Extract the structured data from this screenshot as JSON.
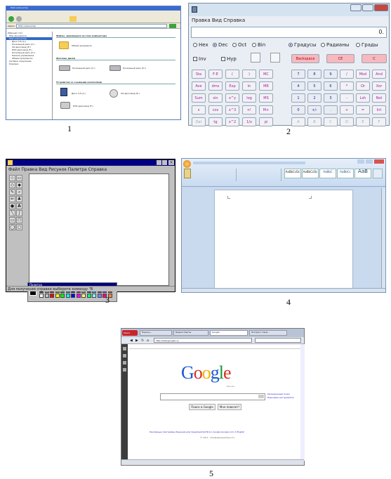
{
  "captions": [
    "1",
    "2",
    "3",
    "4",
    "5"
  ],
  "explorer": {
    "title": "Мой компьютер",
    "address_label": "Адрес:",
    "address_value": "Мой компьютер",
    "section_files": "Файлы, хранящиеся на этом компьютере",
    "shared_docs": "Общие документы",
    "section_hdd": "Жесткие диски",
    "drive_c": "Локальный диск (C:)",
    "drive_d": "Локальный диск (D:)",
    "section_removable": "Устройства со съемными носителями",
    "drive_a": "Диск 3,5 (A:)",
    "drive_cd": "CD-дисковод (E:)",
    "drive_dvd": "DVD-дисковод (F:)",
    "tree": [
      "Рабочий стол",
      "Мои документы",
      "Мой компьютер",
      "Диск 3,5 (A:)",
      "Локальный диск (C:)",
      "CD-дисковод (E:)",
      "DVD-дисковод (F:)",
      "Локальный диск (D:)",
      "Панель управления",
      "Общие документы",
      "Сетевое окружение",
      "Корзина"
    ]
  },
  "calculator": {
    "menu": "Правка  Вид  Справка",
    "display": "0.",
    "radios": [
      "Hex",
      "Dec",
      "Oct",
      "Bin"
    ],
    "angle_radios": [
      "Градусы",
      "Радианы",
      "Грады"
    ],
    "checks": [
      "Inv",
      "Hyp"
    ],
    "top_keys": [
      "Backspace",
      "CE",
      "C"
    ],
    "func_keys": [
      [
        "Sta",
        "F-E",
        "(",
        ")",
        "MC"
      ],
      [
        "Ave",
        "dms",
        "Exp",
        "ln",
        "MR"
      ],
      [
        "Sum",
        "sin",
        "x^y",
        "log",
        "MS"
      ],
      [
        "s",
        "cos",
        "x^3",
        "n!",
        "M+"
      ],
      [
        "Dat",
        "tg",
        "x^2",
        "1/x",
        "pi"
      ]
    ],
    "num_keys": [
      [
        "7",
        "8",
        "9",
        "/",
        "Mod",
        "And"
      ],
      [
        "4",
        "5",
        "6",
        "*",
        "Or",
        "Xor"
      ],
      [
        "1",
        "2",
        "3",
        "-",
        "Lsh",
        "Not"
      ],
      [
        "0",
        "+/-",
        ".",
        "+",
        "=",
        "Int"
      ],
      [
        "A",
        "B",
        "C",
        "D",
        "E",
        "F"
      ]
    ]
  },
  "paint": {
    "menu": "Файл  Правка  Вид  Рисунок  Палитра  Справка",
    "palette_title": "Палитра",
    "status": "Для получения справки выберите команду \"В",
    "colors": [
      "#000000",
      "#808080",
      "#800000",
      "#808000",
      "#008000",
      "#008080",
      "#000080",
      "#800080",
      "#808040",
      "#004040",
      "#0080ff",
      "#004080",
      "#8000ff",
      "#804000",
      "#ffffff",
      "#c0c0c0",
      "#ff0000",
      "#ffff00",
      "#00ff00",
      "#00ffff",
      "#0000ff",
      "#ff00ff",
      "#ffff80",
      "#00ff80",
      "#80ffff",
      "#8080ff",
      "#ff0080",
      "#ff8040"
    ]
  },
  "word": {
    "styles": [
      "AaBbCcDc",
      "AaBbCcDc",
      "AaBbC",
      "AaBbCc",
      "AaB"
    ]
  },
  "browser": {
    "tabs": [
      "Opera",
      "Панель...",
      "Яндекс.Карты",
      "Google",
      "Экспресс-пане..."
    ],
    "address": "http://www.google.ru/",
    "logo": "Google",
    "logo_sub": "Россия",
    "btn_search": "Поиск в Google",
    "btn_lucky": "Мне повезет!",
    "adv_search": "Расширенный поиск",
    "lang_tools": "Языковые инструменты",
    "footer_links": "Рекламные программы    Решения для предприятий    Всё о Google    Google.com in English",
    "copyright": "© 2011 - Конфиденциальность"
  }
}
